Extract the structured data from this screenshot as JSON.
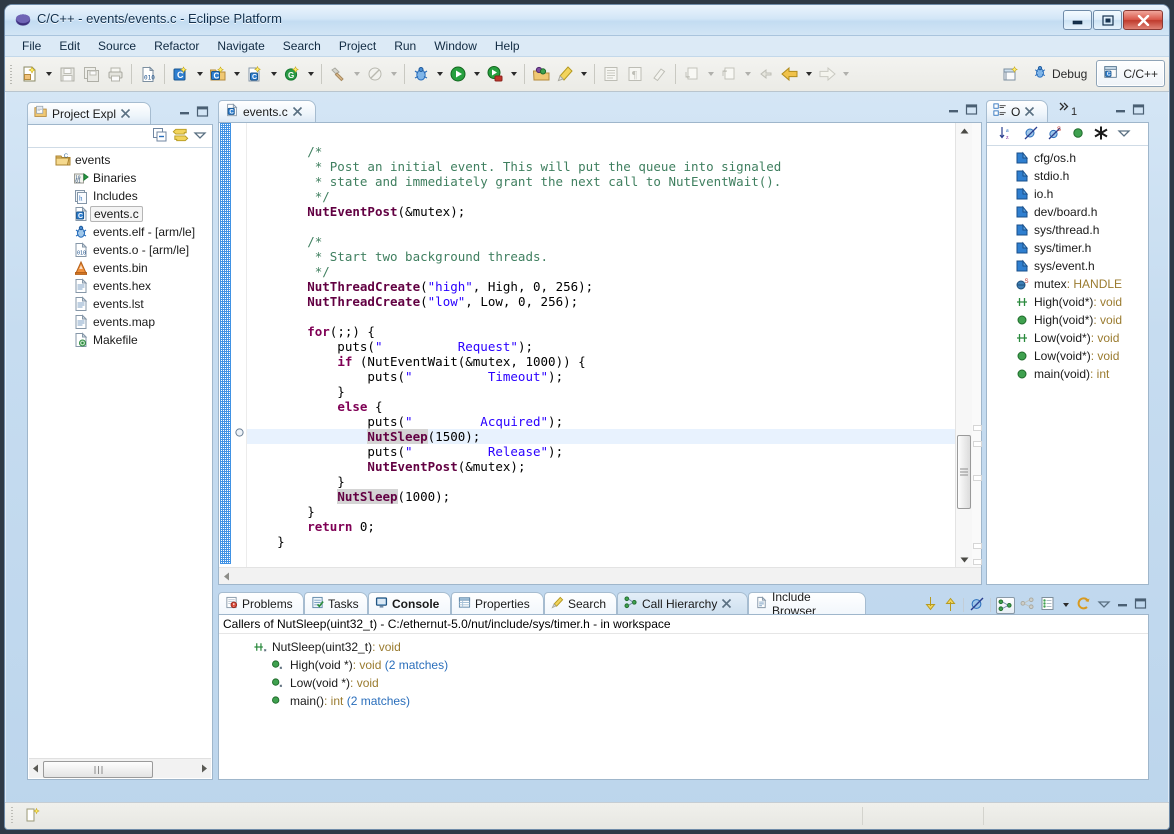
{
  "window": {
    "title": "C/C++ - events/events.c - Eclipse Platform",
    "app_icon": "eclipse-icon",
    "minimize_label": "Minimize",
    "maximize_label": "Maximize",
    "close_label": "Close"
  },
  "menubar": {
    "items": [
      {
        "label": "File"
      },
      {
        "label": "Edit"
      },
      {
        "label": "Source"
      },
      {
        "label": "Refactor"
      },
      {
        "label": "Navigate"
      },
      {
        "label": "Search"
      },
      {
        "label": "Project"
      },
      {
        "label": "Run"
      },
      {
        "label": "Window"
      },
      {
        "label": "Help"
      }
    ]
  },
  "toolbar": {
    "groups": [
      {
        "icons": [
          "new-file-icon",
          "save-icon",
          "save-all-icon",
          "print-icon"
        ]
      },
      {
        "icons": [
          "build-binary-icon"
        ]
      },
      {
        "icons": [
          "new-c-project-icon",
          "new-c-folder-icon",
          "new-c-file-icon",
          "new-class-icon"
        ]
      },
      {
        "icons": [
          "build-hammer-icon",
          "clean-icon"
        ]
      },
      {
        "icons": [
          "debug-bug-icon",
          "run-icon",
          "external-tools-icon"
        ]
      },
      {
        "icons": [
          "open-type-icon",
          "search-marker-icon"
        ]
      },
      {
        "icons": [
          "toggle-block-icon",
          "show-whitespace-icon",
          "eraser-icon"
        ]
      },
      {
        "icons": [
          "next-annotation-icon",
          "previous-annotation-icon",
          "last-edit-icon",
          "back-icon",
          "forward-icon"
        ]
      }
    ]
  },
  "perspective": {
    "open_perspective_icon": "open-perspective-icon",
    "items": [
      {
        "label": "Debug",
        "icon": "debug-perspective-icon",
        "active": false
      },
      {
        "label": "C/C++",
        "icon": "cpp-perspective-icon",
        "active": true
      }
    ]
  },
  "project_explorer": {
    "tab_label": "Project Expl",
    "tab_icon": "project-explorer-icon",
    "close_icon": "close-icon",
    "minimize_icon": "minimize-icon",
    "maximize_icon": "maximize-icon",
    "toolbar_icons": [
      "collapse-all-icon",
      "link-with-editor-icon",
      "view-menu-icon"
    ],
    "tree": [
      {
        "label": "events",
        "icon": "c-project-icon",
        "indent": 0,
        "selected": false
      },
      {
        "label": "Binaries",
        "icon": "binaries-icon",
        "indent": 1,
        "selected": false
      },
      {
        "label": "Includes",
        "icon": "includes-icon",
        "indent": 1,
        "selected": false
      },
      {
        "label": "events.c",
        "icon": "c-file-icon",
        "indent": 1,
        "selected": true
      },
      {
        "label": "events.elf - [arm/le]",
        "icon": "executable-icon",
        "indent": 1,
        "selected": false
      },
      {
        "label": "events.o - [arm/le]",
        "icon": "object-file-icon",
        "indent": 1,
        "selected": false
      },
      {
        "label": "events.bin",
        "icon": "binary-file-icon",
        "indent": 1,
        "selected": false
      },
      {
        "label": "events.hex",
        "icon": "text-file-icon",
        "indent": 1,
        "selected": false
      },
      {
        "label": "events.lst",
        "icon": "text-file-icon",
        "indent": 1,
        "selected": false
      },
      {
        "label": "events.map",
        "icon": "text-file-icon",
        "indent": 1,
        "selected": false
      },
      {
        "label": "Makefile",
        "icon": "makefile-icon",
        "indent": 1,
        "selected": false
      }
    ],
    "hscroll": {
      "left_arrow": "scroll-left-icon",
      "right_arrow": "scroll-right-icon"
    }
  },
  "editor": {
    "tab_label": "events.c",
    "tab_icon": "c-file-icon",
    "close_icon": "close-icon",
    "minimize_icon": "minimize-icon",
    "maximize_icon": "maximize-icon",
    "highlight_line_index": 20,
    "lines": [
      [],
      [
        {
          "t": "        ",
          "c": ""
        },
        {
          "t": "/*",
          "c": "cmt"
        }
      ],
      [
        {
          "t": "         ",
          "c": ""
        },
        {
          "t": "* Post an initial event. This will put the queue into signaled",
          "c": "cmt"
        }
      ],
      [
        {
          "t": "         ",
          "c": ""
        },
        {
          "t": "* state and immediately grant the next call to NutEventWait().",
          "c": "cmt"
        }
      ],
      [
        {
          "t": "         ",
          "c": ""
        },
        {
          "t": "*/",
          "c": "cmt"
        }
      ],
      [
        {
          "t": "        ",
          "c": ""
        },
        {
          "t": "NutEventPost",
          "c": "fn"
        },
        {
          "t": "(&mutex);",
          "c": ""
        }
      ],
      [],
      [
        {
          "t": "        ",
          "c": ""
        },
        {
          "t": "/*",
          "c": "cmt"
        }
      ],
      [
        {
          "t": "         ",
          "c": ""
        },
        {
          "t": "* Start two background threads.",
          "c": "cmt"
        }
      ],
      [
        {
          "t": "         ",
          "c": ""
        },
        {
          "t": "*/",
          "c": "cmt"
        }
      ],
      [
        {
          "t": "        ",
          "c": ""
        },
        {
          "t": "NutThreadCreate",
          "c": "fn"
        },
        {
          "t": "(",
          "c": ""
        },
        {
          "t": "\"high\"",
          "c": "str"
        },
        {
          "t": ", High, 0, 256);",
          "c": ""
        }
      ],
      [
        {
          "t": "        ",
          "c": ""
        },
        {
          "t": "NutThreadCreate",
          "c": "fn"
        },
        {
          "t": "(",
          "c": ""
        },
        {
          "t": "\"low\"",
          "c": "str"
        },
        {
          "t": ", Low, 0, 256);",
          "c": ""
        }
      ],
      [],
      [
        {
          "t": "        ",
          "c": ""
        },
        {
          "t": "for",
          "c": "kw"
        },
        {
          "t": "(;;) {",
          "c": ""
        }
      ],
      [
        {
          "t": "            puts(",
          "c": ""
        },
        {
          "t": "\"          Request\"",
          "c": "str"
        },
        {
          "t": ");",
          "c": ""
        }
      ],
      [
        {
          "t": "            ",
          "c": ""
        },
        {
          "t": "if",
          "c": "kw"
        },
        {
          "t": " (NutEventWait(&mutex, 1000)) {",
          "c": ""
        }
      ],
      [
        {
          "t": "                puts(",
          "c": ""
        },
        {
          "t": "\"          Timeout\"",
          "c": "str"
        },
        {
          "t": ");",
          "c": ""
        }
      ],
      [
        {
          "t": "            }",
          "c": ""
        }
      ],
      [
        {
          "t": "            ",
          "c": ""
        },
        {
          "t": "else",
          "c": "kw"
        },
        {
          "t": " {",
          "c": ""
        }
      ],
      [
        {
          "t": "                puts(",
          "c": ""
        },
        {
          "t": "\"         Acquired\"",
          "c": "str"
        },
        {
          "t": ");",
          "c": ""
        }
      ],
      [
        {
          "t": "                ",
          "c": ""
        },
        {
          "t": "NutSleep",
          "c": "fn occ"
        },
        {
          "t": "(1500);",
          "c": ""
        }
      ],
      [
        {
          "t": "                puts(",
          "c": ""
        },
        {
          "t": "\"          Release\"",
          "c": "str"
        },
        {
          "t": ");",
          "c": ""
        }
      ],
      [
        {
          "t": "                ",
          "c": ""
        },
        {
          "t": "NutEventPost",
          "c": "fn"
        },
        {
          "t": "(&mutex);",
          "c": ""
        }
      ],
      [
        {
          "t": "            }",
          "c": ""
        }
      ],
      [
        {
          "t": "            ",
          "c": ""
        },
        {
          "t": "NutSleep",
          "c": "fn occ"
        },
        {
          "t": "(1000);",
          "c": ""
        }
      ],
      [
        {
          "t": "        }",
          "c": ""
        }
      ],
      [
        {
          "t": "        ",
          "c": ""
        },
        {
          "t": "return",
          "c": "kw"
        },
        {
          "t": " 0;",
          "c": ""
        }
      ],
      [
        {
          "t": "    }",
          "c": ""
        }
      ]
    ]
  },
  "outline": {
    "tab_label": "O",
    "tab_icon": "outline-icon",
    "close_icon": "close-icon",
    "overflow_label": "1",
    "overflow_icon": "chevron-right-right-icon",
    "minimize_icon": "minimize-icon",
    "maximize_icon": "maximize-icon",
    "toolbar_icons": [
      "sort-alpha-icon",
      "hide-fields-icon",
      "hide-static-icon",
      "hide-nonpublic-icon",
      "hide-macros-icon",
      "view-menu-icon"
    ],
    "items": [
      {
        "label": "cfg/os.h",
        "icon": "include-icon",
        "type": ""
      },
      {
        "label": "stdio.h",
        "icon": "include-icon",
        "type": ""
      },
      {
        "label": "io.h",
        "icon": "include-icon",
        "type": ""
      },
      {
        "label": "dev/board.h",
        "icon": "include-icon",
        "type": ""
      },
      {
        "label": "sys/thread.h",
        "icon": "include-icon",
        "type": ""
      },
      {
        "label": "sys/timer.h",
        "icon": "include-icon",
        "type": ""
      },
      {
        "label": "sys/event.h",
        "icon": "include-icon",
        "type": ""
      },
      {
        "label": "mutex",
        "icon": "static-variable-icon",
        "type": " : HANDLE"
      },
      {
        "label": "High(void*)",
        "icon": "function-declaration-icon",
        "type": " : void"
      },
      {
        "label": "High(void*)",
        "icon": "function-definition-icon",
        "type": " : void"
      },
      {
        "label": "Low(void*)",
        "icon": "function-declaration-icon",
        "type": " : void"
      },
      {
        "label": "Low(void*)",
        "icon": "function-definition-icon",
        "type": " : void"
      },
      {
        "label": "main(void)",
        "icon": "function-definition-icon",
        "type": " : int"
      }
    ]
  },
  "bottom_panel": {
    "tabs": [
      {
        "label": "Problems",
        "icon": "problems-icon",
        "active": false,
        "closable": false
      },
      {
        "label": "Tasks",
        "icon": "tasks-icon",
        "active": false,
        "closable": false
      },
      {
        "label": "Console",
        "icon": "console-icon",
        "active": false,
        "closable": false
      },
      {
        "label": "Properties",
        "icon": "properties-icon",
        "active": false,
        "closable": false
      },
      {
        "label": "Search",
        "icon": "search-icon",
        "active": false,
        "closable": false
      },
      {
        "label": "Call Hierarchy",
        "icon": "call-hierarchy-icon",
        "active": true,
        "closable": true
      },
      {
        "label": "Include Browser",
        "icon": "include-browser-icon",
        "active": false,
        "closable": false
      }
    ],
    "toolbar_icons": [
      "expand-down-icon",
      "collapse-up-icon",
      "pin-icon",
      "show-callers-icon",
      "show-callees-icon",
      "history-list-icon",
      "history-menu-icon",
      "refresh-icon",
      "view-menu-icon",
      "minimize-icon",
      "maximize-icon"
    ],
    "header": "Callers of NutSleep(uint32_t) - C:/ethernut-5.0/nut/include/sys/timer.h - in workspace",
    "tree": [
      {
        "label": "NutSleep(uint32_t)",
        "type": " : void",
        "matches": "",
        "icon": "function-declaration-icon",
        "indent": 0
      },
      {
        "label": "High(void *)",
        "type": " : void",
        "matches": "(2 matches)",
        "icon": "function-definition-ref-icon",
        "indent": 1
      },
      {
        "label": "Low(void *)",
        "type": " : void",
        "matches": "",
        "icon": "function-definition-ref-icon",
        "indent": 1
      },
      {
        "label": "main()",
        "type": " : int",
        "matches": "(2 matches)",
        "icon": "function-definition-icon",
        "indent": 1
      }
    ]
  },
  "statusbar": {
    "icon": "editor-state-icon",
    "text": ""
  },
  "colors": {
    "accent": "#2a6ebb",
    "comment": "#3f7f5f",
    "keyword": "#7f0055",
    "string": "#2a00ff",
    "function": "#620042",
    "selection": "#e8f2fe",
    "tab_active": "#dce9f5",
    "type_text": "#9a7b2f"
  }
}
